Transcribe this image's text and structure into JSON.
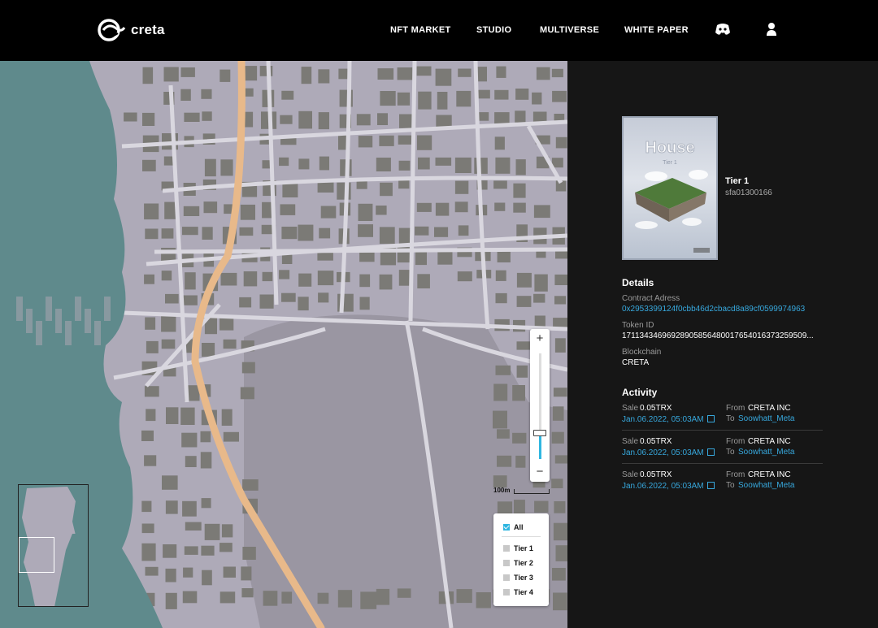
{
  "brand": {
    "name": "creta"
  },
  "nav": {
    "items": [
      "NFT MARKET",
      "STUDIO",
      "MULTIVERSE",
      "WHITE PAPER"
    ],
    "icons": [
      "discord-icon",
      "user-icon"
    ]
  },
  "map": {
    "zoom": {
      "plus": "+",
      "minus": "−",
      "level": 0.22
    },
    "scale_label": "100m",
    "legend": [
      {
        "label": "All",
        "checked": true
      },
      {
        "label": "Tier 1",
        "checked": false
      },
      {
        "label": "Tier 2",
        "checked": false
      },
      {
        "label": "Tier 3",
        "checked": false
      },
      {
        "label": "Tier 4",
        "checked": false
      }
    ],
    "colors": {
      "water": "#5f8a8c",
      "land": "#aeaab8",
      "block": "#7b7a76",
      "road": "#d9d7df",
      "highway": "#e8b98a",
      "park": "#9a96a2"
    }
  },
  "nft": {
    "card_title": "House",
    "card_subtitle": "Tier 1",
    "tier": "Tier 1",
    "code": "sfa01300166"
  },
  "details": {
    "heading": "Details",
    "contract_label": "Contract Adress",
    "contract_value": "0x2953399124f0cbb46d2cbacd8a89cf0599974963",
    "token_label": "Token ID",
    "token_value": "17113434696928905856480017654016373259509...",
    "chain_label": "Blockchain",
    "chain_value": "CRETA"
  },
  "activity": {
    "heading": "Activity",
    "rows": [
      {
        "type": "Sale",
        "amount": "0.05TRX",
        "date": "Jan.06.2022, 05:03AM",
        "from_label": "From",
        "from": "CRETA INC",
        "to_label": "To",
        "to": "Soowhatt_Meta"
      },
      {
        "type": "Sale",
        "amount": "0.05TRX",
        "date": "Jan.06.2022, 05:03AM",
        "from_label": "From",
        "from": "CRETA INC",
        "to_label": "To",
        "to": "Soowhatt_Meta"
      },
      {
        "type": "Sale",
        "amount": "0.05TRX",
        "date": "Jan.06.2022, 05:03AM",
        "from_label": "From",
        "from": "CRETA INC",
        "to_label": "To",
        "to": "Soowhatt_Meta"
      }
    ]
  }
}
